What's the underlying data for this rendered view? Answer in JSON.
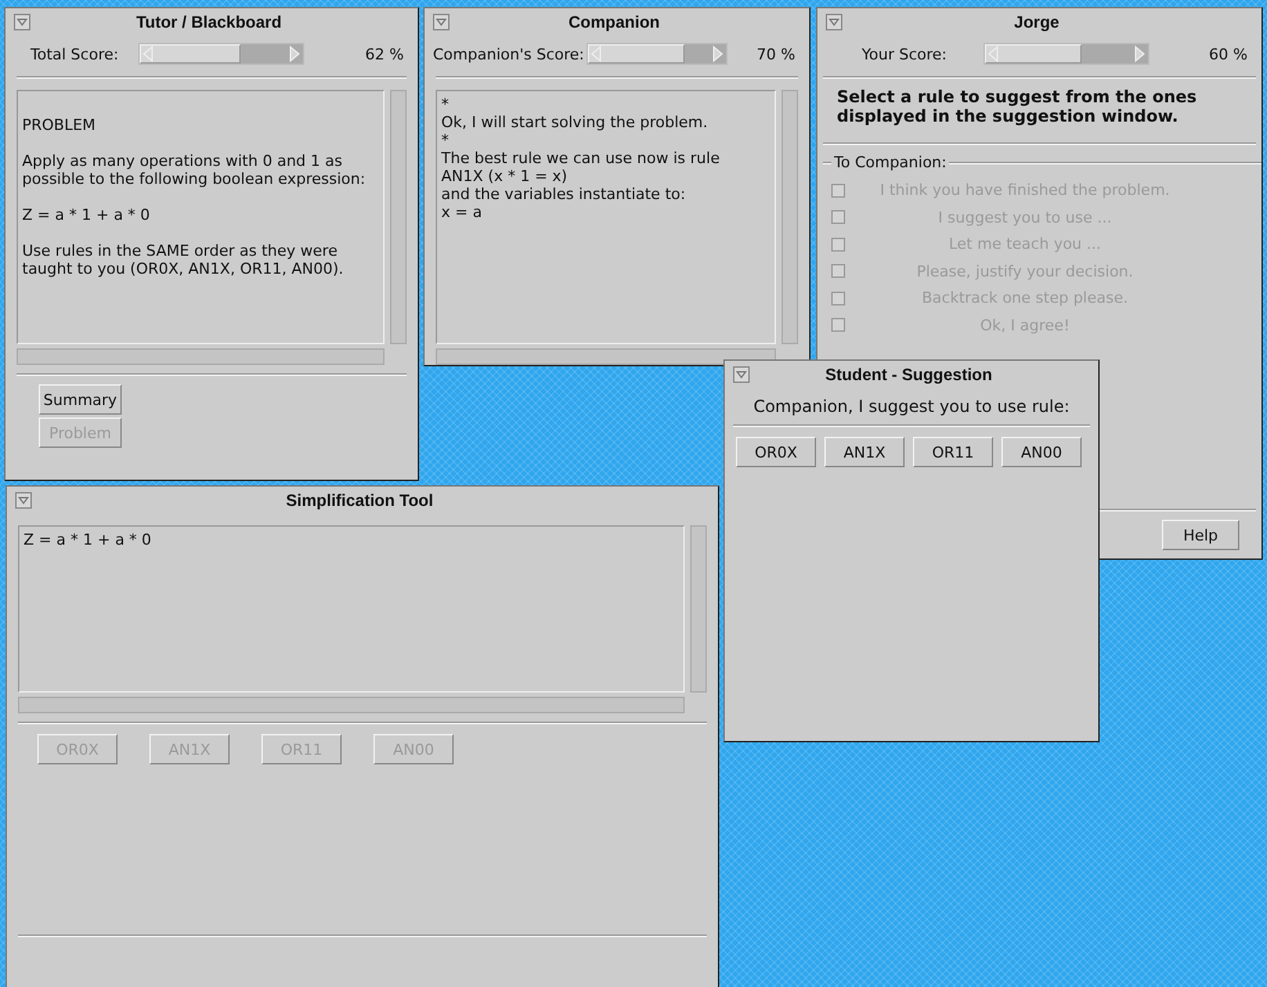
{
  "tutor_window": {
    "title": "Tutor / Blackboard",
    "score": {
      "label": "Total Score:",
      "level": 0.62,
      "reading": "62 %"
    },
    "text_area": {
      "paragraphs": [
        "PROBLEM",
        "Apply as many operations with 0 and 1 as possible to the following boolean expression:",
        "Z = a * 1 + a * 0",
        "Use rules in the SAME order as they were taught to you (OR0X, AN1X, OR11, AN00)."
      ]
    },
    "buttons": [
      {
        "label": "Summary",
        "disabled": false
      },
      {
        "label": "Problem",
        "disabled": true
      }
    ]
  },
  "companion_window": {
    "title": "Companion",
    "score": {
      "label": "Companion's Score:",
      "level": 0.7,
      "reading": "70 %"
    },
    "text_area": {
      "lines": [
        "*",
        "Ok, I will start solving the problem.",
        "*",
        "The best rule we can use now is rule",
        "AN1X (x * 1 = x)",
        "and the variables instantiate to:",
        "x = a"
      ]
    }
  },
  "jorge_window": {
    "title": "Jorge",
    "score": {
      "label": "Your Score:",
      "level": 0.6,
      "reading": "60 %"
    },
    "instruction": "Select a rule to suggest from the ones displayed in the suggestion window.",
    "group": {
      "label": "To Companion:",
      "options": [
        {
          "label": "I think you have finished the problem.",
          "checked": false,
          "disabled": true
        },
        {
          "label": "I suggest you to use ...",
          "checked": false,
          "disabled": true
        },
        {
          "label": "Let me teach you ...",
          "checked": false,
          "disabled": true
        },
        {
          "label": "Please, justify your decision.",
          "checked": false,
          "disabled": true
        },
        {
          "label": "Backtrack one step please.",
          "checked": false,
          "disabled": true
        },
        {
          "label": "Ok, I agree!",
          "checked": false,
          "disabled": true
        }
      ]
    },
    "buttons": [
      {
        "label": "Help",
        "disabled": false
      }
    ]
  },
  "suggestion_window": {
    "title": "Student - Suggestion",
    "prompt": "Companion, I suggest you to use rule:",
    "rule_buttons": [
      {
        "label": "OR0X",
        "disabled": false
      },
      {
        "label": "AN1X",
        "disabled": false
      },
      {
        "label": "OR11",
        "disabled": false
      },
      {
        "label": "AN00",
        "disabled": false
      }
    ]
  },
  "simplification_window": {
    "title": "Simplification Tool",
    "expression": "Z = a * 1 + a * 0",
    "rule_buttons": [
      {
        "label": "OR0X",
        "disabled": true
      },
      {
        "label": "AN1X",
        "disabled": true
      },
      {
        "label": "OR11",
        "disabled": true
      },
      {
        "label": "AN00",
        "disabled": true
      }
    ]
  }
}
